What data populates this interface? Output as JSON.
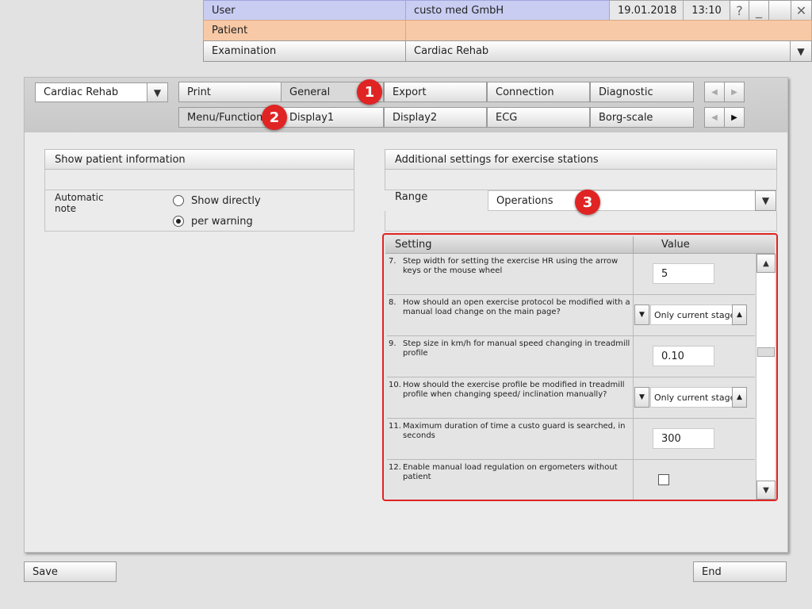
{
  "header": {
    "user_label": "User",
    "user_value": "custo med GmbH",
    "date": "19.01.2018",
    "time": "13:10",
    "help_symbol": "?",
    "minimize_symbol": "_",
    "close_symbol": "✕",
    "patient_label": "Patient",
    "patient_value": "",
    "examination_label": "Examination",
    "examination_value": "Cardiac Rehab",
    "dropdown_symbol": "▼"
  },
  "toolbar": {
    "profile_select": "Cardiac Rehab",
    "tabs_row1": [
      "Print",
      "General",
      "Export",
      "Connection",
      "Diagnostic"
    ],
    "tabs_row2": [
      "Menu/Functions",
      "Display1",
      "Display2",
      "ECG",
      "Borg-scale"
    ],
    "prev_symbol": "◀",
    "next_symbol": "▶",
    "dropdown_symbol": "▼"
  },
  "badges": [
    "1",
    "2",
    "3"
  ],
  "left_panel": {
    "title": "Show patient information",
    "note_label": "Automatic note",
    "options": [
      "Show directly",
      "per warning"
    ],
    "selected_index": 1
  },
  "right_panel": {
    "title": "Additional settings for exercise stations",
    "range_label": "Range",
    "range_value": "Operations",
    "dropdown_symbol": "▼",
    "table": {
      "col_setting": "Setting",
      "col_value": "Value",
      "rows": [
        {
          "num": "7.",
          "text": "Step width for setting the exercise HR using the arrow keys or the mouse wheel",
          "type": "number",
          "value": "5"
        },
        {
          "num": "8.",
          "text": "How should an open exercise protocol be modified with a manual load change on the main page?",
          "type": "select",
          "value": "Only current stage"
        },
        {
          "num": "9.",
          "text": "Step size in km/h for manual speed changing in treadmill profile",
          "type": "number",
          "value": "0.10"
        },
        {
          "num": "10.",
          "text": "How should the exercise profile be modified in treadmill profile when changing speed/ inclination manually?",
          "type": "select",
          "value": "Only current stage"
        },
        {
          "num": "11.",
          "text": "Maximum duration of time a custo guard is searched, in seconds",
          "type": "number",
          "value": "300"
        },
        {
          "num": "12.",
          "text": "Enable manual load regulation on ergometers without patient",
          "type": "checkbox",
          "value": ""
        }
      ],
      "scroll_up_symbol": "▲",
      "scroll_down_symbol": "▼",
      "spinner_left_symbol": "▼",
      "spinner_right_symbol": "▲"
    }
  },
  "footer": {
    "save_label": "Save",
    "end_label": "End"
  },
  "colors": {
    "user_row": "#c9cdf2",
    "patient_row": "#f8c9a6",
    "highlight_border": "#e02424",
    "badge": "#e02424"
  }
}
